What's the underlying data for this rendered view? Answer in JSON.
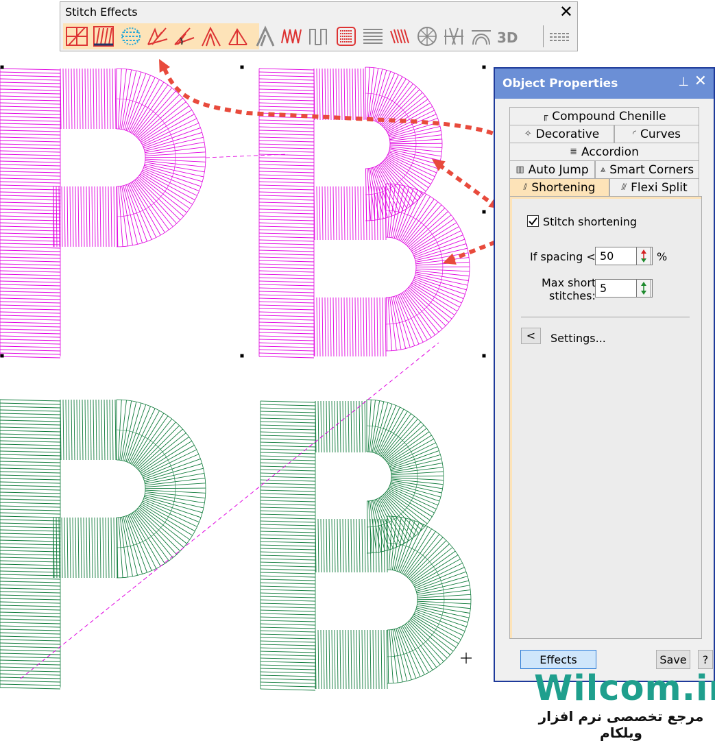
{
  "toolbar": {
    "title": "Stitch Effects",
    "close_icon": "close-icon",
    "highlight_color": "#fde3b8",
    "items": [
      {
        "icon": "pattern-outline-icon",
        "active": true
      },
      {
        "icon": "fixed-pattern-icon",
        "active": true
      },
      {
        "icon": "trapunto-icon",
        "active": true
      },
      {
        "icon": "tatami-offsets-icon",
        "active": true
      },
      {
        "icon": "step-angles-icon",
        "active": true
      },
      {
        "icon": "auto-spacing-icon",
        "active": true
      },
      {
        "icon": "shortening-icon",
        "active": true
      },
      {
        "icon": "smart-corners-icon",
        "active": false
      },
      {
        "icon": "zigzag-icon",
        "active": false
      },
      {
        "icon": "e-stitch-icon",
        "active": false
      },
      {
        "icon": "raised-satin-icon",
        "active": false
      },
      {
        "icon": "lines-icon",
        "active": false
      },
      {
        "icon": "flexi-split-icon",
        "active": false
      },
      {
        "icon": "radial-icon",
        "active": false
      },
      {
        "icon": "chenille-icon",
        "active": false
      },
      {
        "icon": "curves-icon",
        "active": false
      },
      {
        "icon": "3d-icon",
        "label": "3D",
        "active": false
      },
      {
        "icon": "accordion-icon",
        "active": false
      }
    ]
  },
  "panel": {
    "title": "Object Properties",
    "pin_icon": "pin-icon",
    "close_icon": "close-icon",
    "tabs": {
      "compound_chenille": "Compound Chenille",
      "decorative": "Decorative",
      "curves": "Curves",
      "accordion": "Accordion",
      "auto_jump": "Auto Jump",
      "smart_corners": "Smart Corners",
      "shortening": "Shortening",
      "flexi_split": "Flexi Split"
    },
    "active_tab": "Shortening",
    "stitch_shortening_label": "Stitch shortening",
    "stitch_shortening_checked": true,
    "spacing_label": "If spacing <",
    "spacing_value": "50",
    "spacing_unit": "%",
    "max_short_label_1": "Max short",
    "max_short_label_2": "stitches:",
    "max_short_value": "5",
    "settings_toggle": "<",
    "settings_label": "Settings...",
    "effects_button": "Effects",
    "save_button": "Save",
    "help_button": "?"
  },
  "watermark": {
    "brand": "Wilcom.ir",
    "subtitle": "مرجع تخصصی نرم افزار ویلکام"
  },
  "colors": {
    "magenta_stitch": "#e000e0",
    "green_stitch": "#0e7a3a",
    "arrow_red": "#e84a3c",
    "panel_title": "#6b8fd6",
    "watermark_teal": "#1f9f8d"
  }
}
